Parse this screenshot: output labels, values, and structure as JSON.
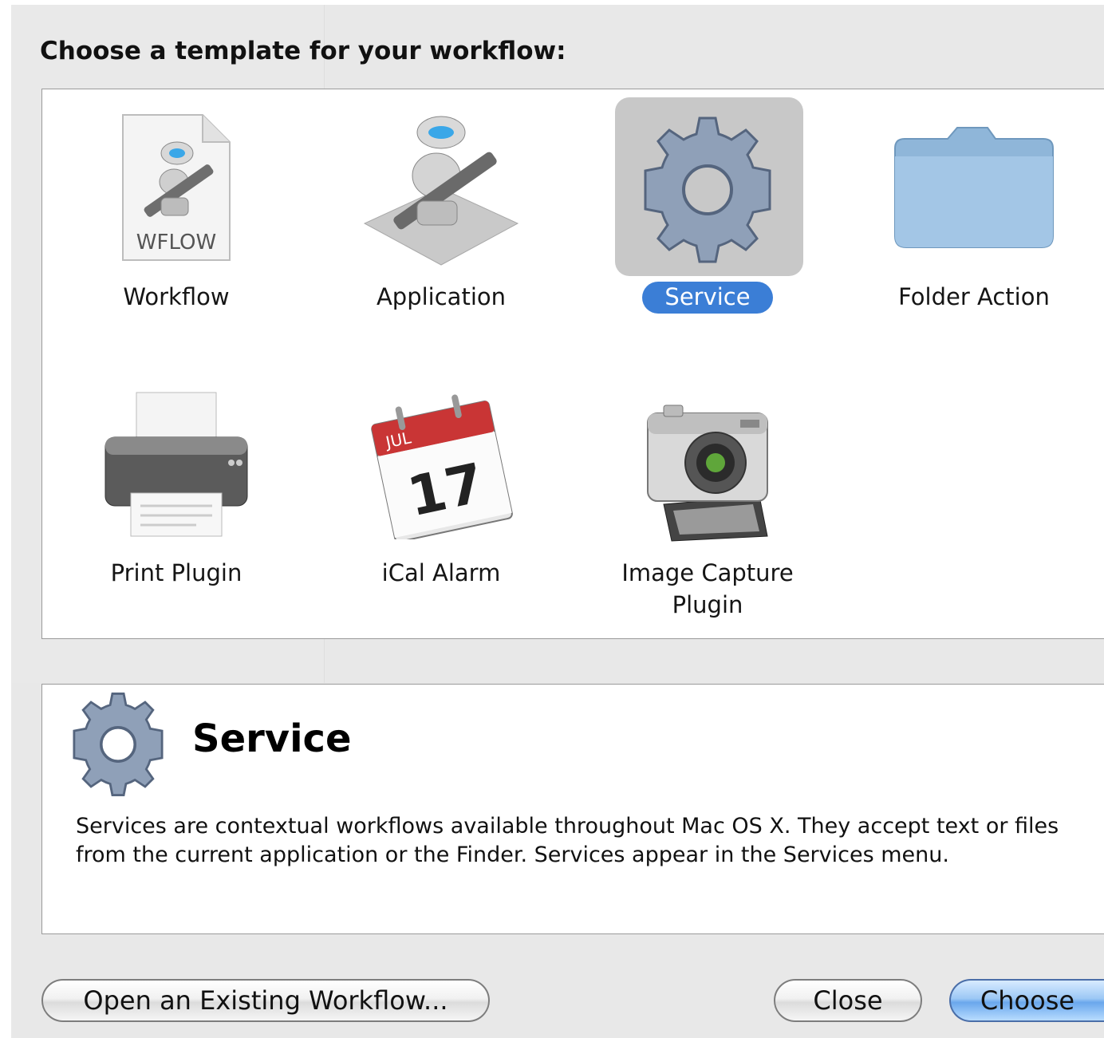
{
  "dialog": {
    "prompt": "Choose a template for your workflow:"
  },
  "templates": [
    {
      "label": "Workflow",
      "icon": "workflow-document-icon",
      "badge": "WFLOW",
      "selected": false
    },
    {
      "label": "Application",
      "icon": "automator-application-icon",
      "selected": false
    },
    {
      "label": "Service",
      "icon": "gear-icon",
      "selected": true
    },
    {
      "label": "Folder Action",
      "icon": "folder-icon",
      "selected": false
    },
    {
      "label": "Print Plugin",
      "icon": "printer-icon",
      "selected": false
    },
    {
      "label": "iCal Alarm",
      "icon": "calendar-icon",
      "month": "JUL",
      "day": "17",
      "selected": false
    },
    {
      "label": "Image Capture\nPlugin",
      "icon": "camera-icon",
      "selected": false
    }
  ],
  "description": {
    "icon": "gear-icon",
    "title": "Service",
    "text": "Services are contextual workflows available throughout Mac OS X. They accept text or files from the current application or the Finder. Services appear in the Services menu."
  },
  "buttons": {
    "open_existing": "Open an Existing Workflow...",
    "close": "Close",
    "choose": "Choose"
  },
  "colors": {
    "selection": "#3b7ed6",
    "selection_tile": "#c8c8c8",
    "gear": "#8e9fb6",
    "folder": "#8fb6d9"
  }
}
